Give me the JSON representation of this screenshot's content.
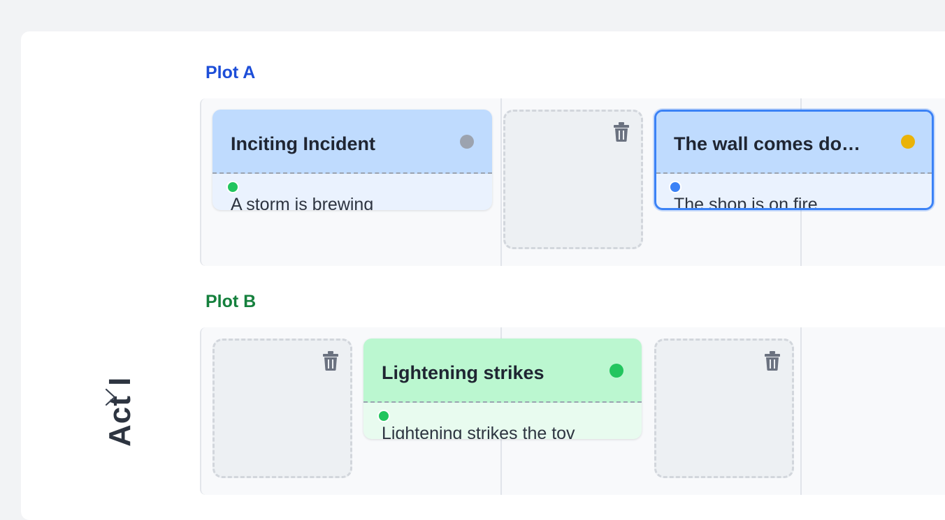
{
  "act": {
    "label": "Act I"
  },
  "colors": {
    "plot_a_title": "#1d4ed8",
    "plot_b_title": "#15803d",
    "blue_head": "#bfdbfe",
    "blue_body": "#eaf2fe",
    "green_head": "#bbf7d0",
    "green_body": "#e8fbef",
    "selected_border": "#3b82f6"
  },
  "plots": [
    {
      "title": "Plot A",
      "cards": [
        {
          "title": "Inciting Incident",
          "status_color": "#9ca3af",
          "body_dot_color": "#22c55e",
          "body": "A storm is brewing"
        },
        {
          "empty": true
        },
        {
          "title": "The wall comes do…",
          "status_color": "#eab308",
          "body_dot_color": "#3b82f6",
          "body": "The shop is on fire",
          "selected": true
        }
      ]
    },
    {
      "title": "Plot B",
      "cards": [
        {
          "empty": true
        },
        {
          "title": "Lightening strikes",
          "status_color": "#22c55e",
          "body_dot_color": "#22c55e",
          "body": "Lightening strikes the tov"
        },
        {
          "empty": true
        }
      ]
    }
  ]
}
